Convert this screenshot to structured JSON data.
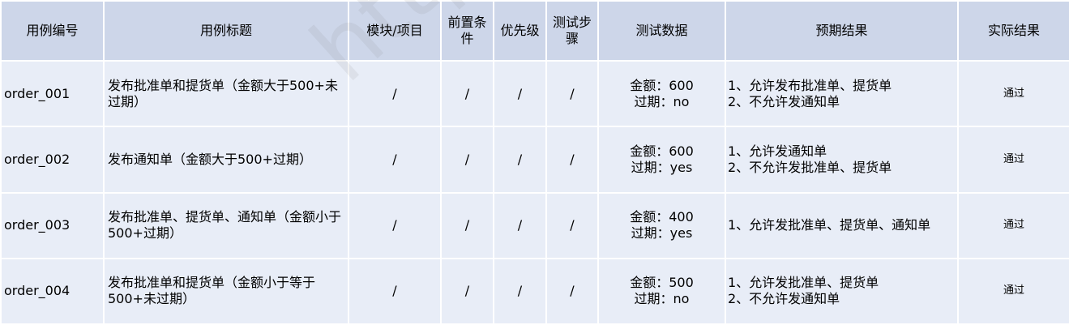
{
  "headers": {
    "id": "用例编号",
    "title": "用例标题",
    "module": "模块/项目",
    "precondition": "前置条件",
    "priority": "优先级",
    "steps": "测试步骤",
    "test_data": "测试数据",
    "expected": "预期结果",
    "actual": "实际结果"
  },
  "rows": [
    {
      "id": "order_001",
      "title": "发布批准单和提货单（金额大于500+未过期）",
      "module": "/",
      "precondition": "/",
      "priority": "/",
      "steps": "/",
      "data_line1": "金额：600",
      "data_line2": "过期：no",
      "expected_line1": "1、允许发布批准单、提货单",
      "expected_line2": "2、不允许发通知单",
      "actual": "通过"
    },
    {
      "id": "order_002",
      "title": "发布通知单（金额大于500+过期）",
      "module": "/",
      "precondition": "/",
      "priority": "/",
      "steps": "/",
      "data_line1": "金额：600",
      "data_line2": "过期：yes",
      "expected_line1": "1、允许发通知单",
      "expected_line2": "2、不允许发批准单、提货单",
      "actual": "通过"
    },
    {
      "id": "order_003",
      "title": "发布批准单、提货单、通知单（金额小于500+过期）",
      "module": "/",
      "precondition": "/",
      "priority": "/",
      "steps": "/",
      "data_line1": "金额：400",
      "data_line2": "过期：yes",
      "expected_line1": "1、允许发批准单、提货单、通知单",
      "expected_line2": "",
      "actual": "通过"
    },
    {
      "id": "order_004",
      "title": "发布批准单和提货单（金额小于等于500+未过期）",
      "module": "/",
      "precondition": "/",
      "priority": "/",
      "steps": "/",
      "data_line1": "金额：500",
      "data_line2": "过期：no",
      "expected_line1": "1、允许发批准单、提货单",
      "expected_line2": "2、不允许发通知单",
      "actual": "通过"
    }
  ],
  "watermark": "http://www.itheima.com"
}
